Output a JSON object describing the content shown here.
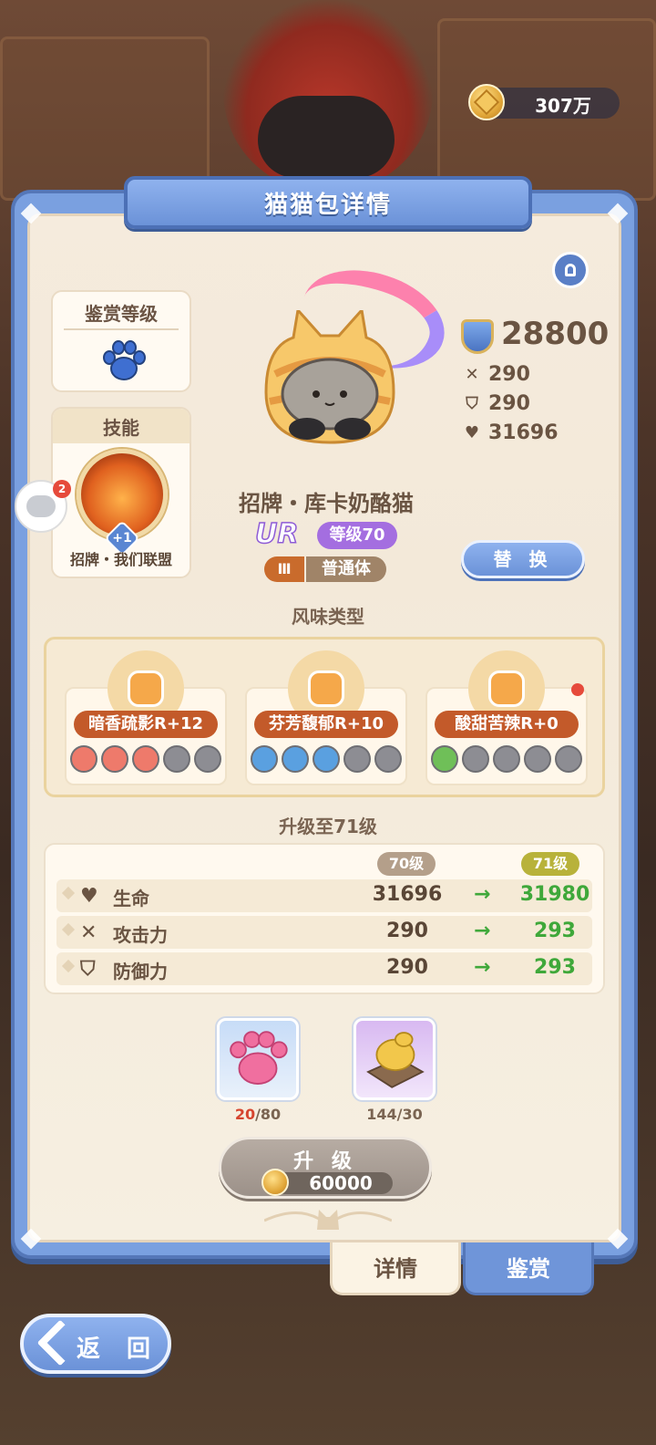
{
  "currency": {
    "gold": "307万",
    "icon": "coin-icon"
  },
  "panel": {
    "title": "猫猫包详情"
  },
  "appreciation": {
    "title": "鉴赏等级",
    "icon": "paw-icon"
  },
  "skill": {
    "title": "技能",
    "name": "招牌・我们联盟",
    "plus": "+1"
  },
  "chat": {
    "badge": "2"
  },
  "character": {
    "name": "招牌・库卡奶酪猫",
    "rarity": "UR",
    "level": "等级70",
    "tier": "Ⅲ",
    "body_type": "普通体",
    "power": "28800",
    "attack": "290",
    "defense": "290",
    "hp": "31696"
  },
  "buttons": {
    "replace": "替 换",
    "upgrade": "升 级",
    "back": "返 回"
  },
  "flavor": {
    "title": "风味类型",
    "items": [
      {
        "label": "暗香疏影R+12",
        "icon": "cat-face-icon",
        "filled": 3,
        "total": 5
      },
      {
        "label": "芬芳馥郁R+10",
        "icon": "toaster-icon",
        "filled": 3,
        "total": 5
      },
      {
        "label": "酸甜苦辣R+0",
        "icon": "flame-icon",
        "filled": 1,
        "total": 5
      }
    ]
  },
  "upgrade": {
    "title": "升级至71级",
    "from_level": "70级",
    "to_level": "71级",
    "rows": [
      {
        "name": "生命",
        "icon": "heart-icon",
        "from": "31696",
        "to": "31980"
      },
      {
        "name": "攻击力",
        "icon": "swords-icon",
        "from": "290",
        "to": "293"
      },
      {
        "name": "防御力",
        "icon": "shield-icon",
        "from": "290",
        "to": "293"
      }
    ]
  },
  "materials": [
    {
      "icon": "paw-jelly-icon",
      "have": "20",
      "need": "/80"
    },
    {
      "icon": "cheese-bread-icon",
      "have": "144/30"
    }
  ],
  "upgrade_cost": "60000",
  "tabs": {
    "detail": "详情",
    "appreciation": "鉴赏"
  },
  "colors": {
    "accent_blue": "#6f95d9",
    "green": "#3fa83a",
    "red": "#e64a3b"
  }
}
